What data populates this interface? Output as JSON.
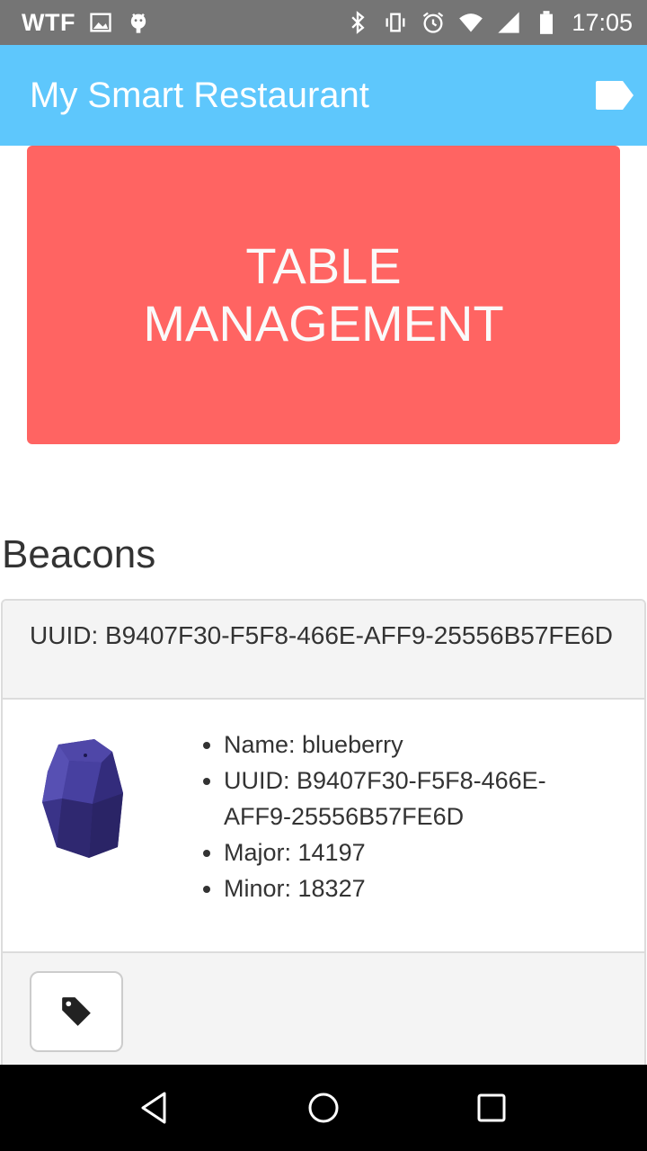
{
  "status_bar": {
    "carrier": "WTF",
    "time": "17:05",
    "icons_left": [
      "image-icon",
      "android-icon"
    ],
    "icons_right": [
      "bluetooth-icon",
      "vibrate-icon",
      "alarm-icon",
      "wifi-icon",
      "signal-icon",
      "battery-icon"
    ]
  },
  "app_bar": {
    "title": "My Smart Restaurant",
    "action_icon": "label-icon",
    "background": "#5ec7fc"
  },
  "main": {
    "table_button_label": "TABLE MANAGEMENT",
    "table_button_color": "#ff6462",
    "section_title": "Beacons"
  },
  "beacon_card": {
    "header": "UUID: B9407F30-F5F8-466E-AFF9-25556B57FE6D",
    "image_icon": "beacon-icon",
    "properties": [
      "Name: blueberry",
      "UUID: B9407F30-F5F8-466E-AFF9-25556B57FE6D",
      "Major: 14197",
      "Minor: 18327"
    ],
    "footer_button_icon": "tag-icon"
  },
  "nav_bar": {
    "buttons": [
      "back-icon",
      "home-icon",
      "recents-icon"
    ]
  }
}
